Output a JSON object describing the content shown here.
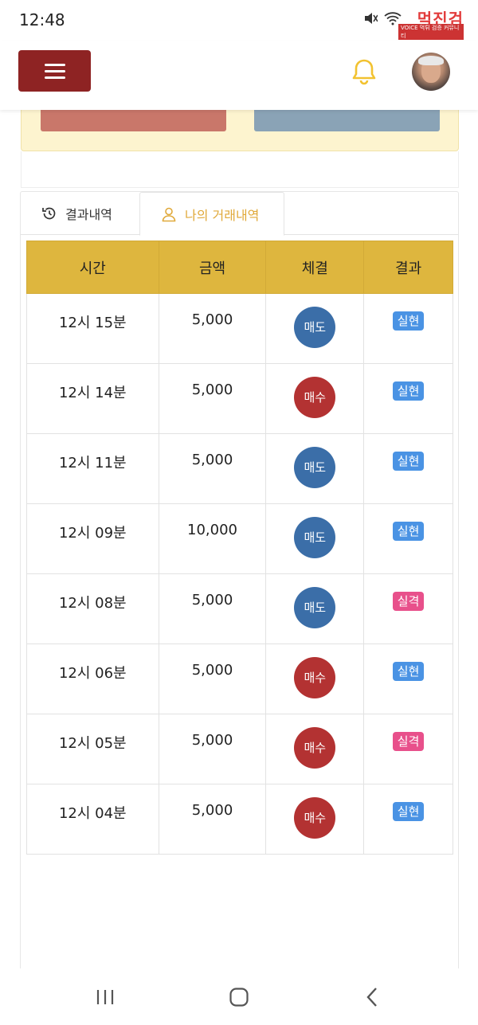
{
  "status_bar": {
    "time": "12:48"
  },
  "watermark": {
    "text": "먹진검",
    "sub": "VOICE 먹튀 검증 커뮤니티"
  },
  "header": {
    "menu_icon": "hamburger-icon",
    "bell_icon": "bell-icon",
    "accent_color": "#8e2323",
    "bell_color": "#f2c230"
  },
  "tabs": [
    {
      "label": "결과내역",
      "icon": "history-icon"
    },
    {
      "label": "나의 거래내역",
      "icon": "user-icon",
      "active": true
    }
  ],
  "table": {
    "headers": [
      "시간",
      "금액",
      "체결",
      "결과"
    ],
    "rows": [
      {
        "time": "12시 15분",
        "amount": "5,000",
        "trade": "매도",
        "trade_type": "sell",
        "result": "실현",
        "result_type": "hit"
      },
      {
        "time": "12시 14분",
        "amount": "5,000",
        "trade": "매수",
        "trade_type": "buy",
        "result": "실현",
        "result_type": "hit"
      },
      {
        "time": "12시 11분",
        "amount": "5,000",
        "trade": "매도",
        "trade_type": "sell",
        "result": "실현",
        "result_type": "hit"
      },
      {
        "time": "12시 09분",
        "amount": "10,000",
        "trade": "매도",
        "trade_type": "sell",
        "result": "실현",
        "result_type": "hit"
      },
      {
        "time": "12시 08분",
        "amount": "5,000",
        "trade": "매도",
        "trade_type": "sell",
        "result": "실격",
        "result_type": "miss"
      },
      {
        "time": "12시 06분",
        "amount": "5,000",
        "trade": "매수",
        "trade_type": "buy",
        "result": "실현",
        "result_type": "hit"
      },
      {
        "time": "12시 05분",
        "amount": "5,000",
        "trade": "매수",
        "trade_type": "buy",
        "result": "실격",
        "result_type": "miss"
      },
      {
        "time": "12시 04분",
        "amount": "5,000",
        "trade": "매수",
        "trade_type": "buy",
        "result": "실현",
        "result_type": "hit"
      }
    ]
  },
  "colors": {
    "sell": "#3b6ea8",
    "buy": "#b33232",
    "hit": "#4a93e4",
    "miss": "#e8508b",
    "table_header": "#deb63e"
  },
  "navbar": {
    "icons": [
      "recent-apps-icon",
      "home-icon",
      "back-icon"
    ]
  }
}
